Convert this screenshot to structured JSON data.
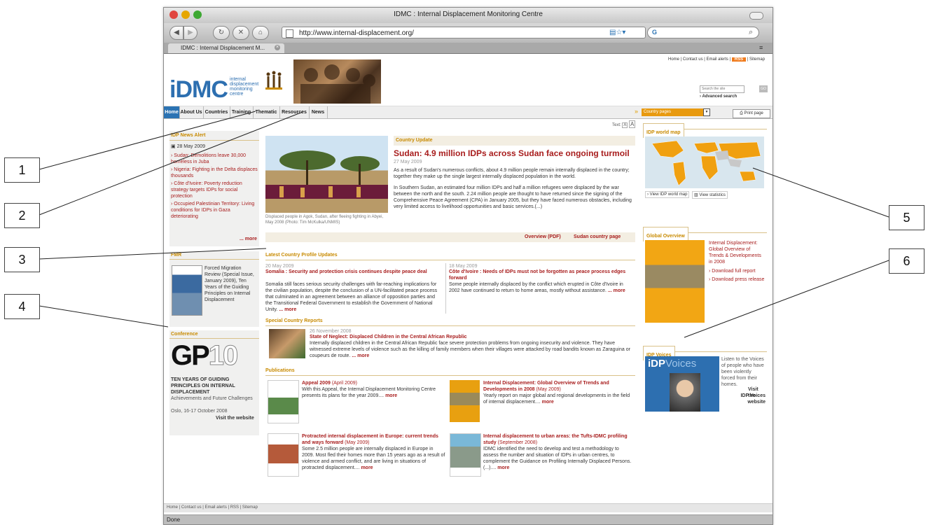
{
  "browser": {
    "window_title": "IDMC : Internal Displacement Monitoring Centre",
    "url": "http://www.internal-displacement.org/",
    "tab_title": "IDMC : Internal Displacement M...",
    "status": "Done"
  },
  "site": {
    "logo_text": "iDMC",
    "logo_sub": [
      "internal",
      "displacement",
      "monitoring",
      "centre"
    ],
    "top_links": [
      "Home",
      "Contact us",
      "Email alerts",
      "RSS",
      "Sitemap"
    ],
    "search_placeholder": "Search the site",
    "search_button": "GO",
    "advanced_search": "Advanced search",
    "nav": [
      "Home",
      "About Us",
      "Countries",
      "Training",
      "Thematic",
      "Resources",
      "News"
    ],
    "country_select": "Country pages",
    "print_page": "Print page",
    "text_size_label": "Text:"
  },
  "left": {
    "news_alert_title": "IDP News Alert",
    "news_date": "28 May 2009",
    "news_items": [
      "Sudan: Demolitions leave 30,000 homeless in Juba",
      "Nigeria: Fighting in the Delta displaces thousands",
      "Côte d'Ivoire: Poverty reduction strategy targets IDPs for social protection",
      "Occupied Palestinian Territory: Living conditions for IDPs in Gaza deteriorating"
    ],
    "more": "... more",
    "fmr_title": "FMR",
    "fmr_text": "Forced Migration Review (Special Issue, January 2009), Ten Years of the Guiding Principles on Internal Displacement",
    "conference_title": "Conference",
    "gp_big": "GP",
    "gp_num": "10",
    "conf_bold": "TEN YEARS OF GUIDING PRINCIPLES ON INTERNAL DISPLACEMENT",
    "conf_sub": "Achievements and Future Challenges",
    "conf_place": "Oslo, 16-17 October 2008",
    "visit_website": "Visit the website"
  },
  "center": {
    "country_update_label": "Country Update",
    "headline": "Sudan: 4.9 million IDPs across Sudan face ongoing turmoil",
    "headline_date": "27 May 2009",
    "para1": "As a result of Sudan's numerous conflicts, about 4.9 million people remain internally displaced in the country; together they make up the single largest internally displaced population in the world.",
    "para2": "In Southern Sudan, an estimated four million IDPs and half a million refugees were displaced by the war between the north and the south. 2.24 million people are thought to have returned since the signing of the Comprehensive Peace Agreement (CPA) in January 2005, but they have faced numerous obstacles, including very limited access to livelihood opportunities and basic services.(...)",
    "photo_caption": "Displaced people in Agok, Sudan, after fleeing fighting in Abyei, May 2008 (Photo: Tim McKulka/UNMIS)",
    "overview_pdf": "Overview (PDF)",
    "sudan_page": "Sudan country page",
    "latest_title": "Latest Country Profile Updates",
    "updates": [
      {
        "date": "20 May 2009",
        "title": "Somalia : Security and protection crisis continues despite peace deal",
        "text": "Somalia still faces serious security challenges with far-reaching implications for the civilian population, despite the conclusion of a UN-facilitated peace process that culminated in an agreement between an alliance of opposition parties and the Transitional Federal Government to establish the Government of National Unity.",
        "more": "... more"
      },
      {
        "date": "18 May 2009",
        "title": "Côte d'Ivoire : Needs of IDPs must not be forgotten as peace process edges forward",
        "text": "Some people internally displaced by the conflict which erupted in Côte d'Ivoire in 2002 have continued to return to home areas, mostly without assistance.",
        "more": "... more"
      }
    ],
    "special_title": "Special Country Reports",
    "special_date": "26 November 2008",
    "special_headline": "State of Neglect: Displaced Children in the Central African Republic",
    "special_text": "Internally displaced children in the Central African Republic face severe protection problems from ongoing insecurity and violence. They have witnessed extreme levels of violence such as the killing of family members when their villages were attacked by road bandits known as Zaraguina or coupeurs de route.",
    "special_more": "... more",
    "pubs_title": "Publications",
    "pubs": [
      {
        "title": "Appeal 2009",
        "date": "(April 2009)",
        "text": "With this Appeal, the Internal Displacement Monitoring Centre presents its plans for the year 2009....",
        "more": "more"
      },
      {
        "title": "Internal Displacement: Global Overview of Trends and Developments in 2008",
        "date": "(May 2009)",
        "text": "Yearly report on major global and regional developments in the field of internal displacement....",
        "more": "more"
      },
      {
        "title": "Protracted internal displacement in Europe: current trends and ways forward",
        "date": "(May 2009)",
        "text": "Some 2.5 million people are internally displaced in Europe in 2009. Most fled their homes more than 15 years ago as a result of violence and armed conflict, and are living in situations of protracted displacement....",
        "more": "more"
      },
      {
        "title": "Internal displacement to urban areas: the Tufts-IDMC profiling study",
        "date": "(September 2008)",
        "text": "IDMC identified the need to develop and test a methodology to assess the number and situation of IDPs in urban centres, to complement the Guidance on Profiling Internally Displaced Persons. (...)....",
        "more": "more"
      }
    ]
  },
  "right": {
    "worldmap_tab": "IDP world map",
    "view_map": "View IDP world map",
    "view_stats": "View statistics",
    "global_tab": "Global Overview",
    "global_text": "Internal Displacement: Global Overview of Trends & Developments in 2008",
    "download_full": "Download full report",
    "download_press": "Download press release",
    "voices_tab": "IDP Voices",
    "voices_logo_a": "iDP",
    "voices_logo_b": "Voices",
    "voices_text": "Listen to the Voices of people who have been violently forced from their homes.",
    "voices_visit": "Visit the",
    "voices_site": "IDP Voices website"
  },
  "footer": {
    "links": "Home | Contact us | Email alerts | RSS | Sitemap"
  },
  "callouts": [
    "1",
    "2",
    "3",
    "4",
    "5",
    "6"
  ],
  "colors": {
    "nav_active": "#2b73b3",
    "brand_blue": "#2d6fb0",
    "accent_orange": "#c88a00",
    "headline_red": "#a81d1d"
  }
}
